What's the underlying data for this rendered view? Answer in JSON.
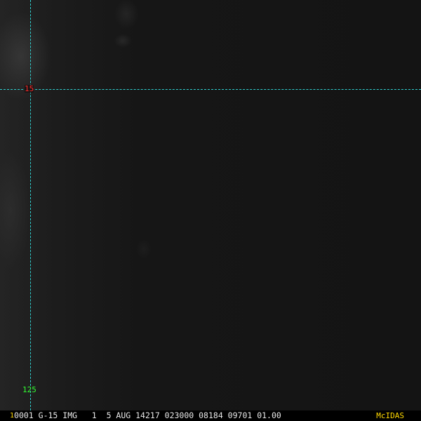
{
  "image": {
    "colors": {
      "background": "#151515",
      "gridline": "#2fd0d0",
      "lat_label": "#ff2a2a",
      "lon_label": "#33ff33",
      "status_text": "#e8e8e8",
      "accent": "#ffd800"
    }
  },
  "grid": {
    "latitude_label": "15",
    "longitude_label": "125"
  },
  "status_bar": {
    "frame_number": "1",
    "text": "0001 G-15 IMG   1  5 AUG 14217 023000 08184 09701 01.00",
    "brand": "McIDAS"
  }
}
